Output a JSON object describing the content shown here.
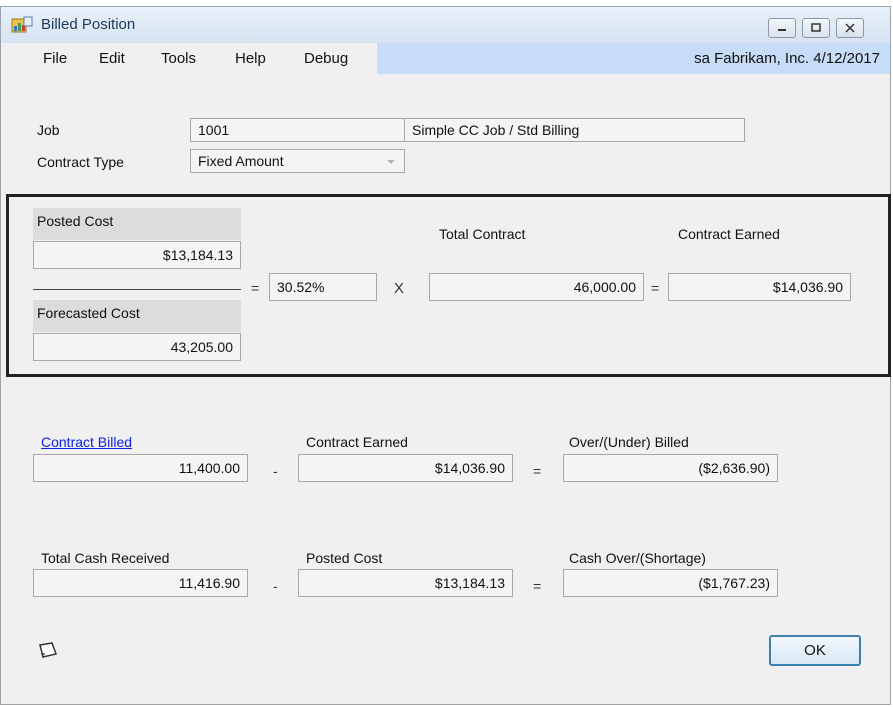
{
  "window": {
    "title": "Billed Position",
    "icon": "billed-position-icon"
  },
  "menu": [
    "File",
    "Edit",
    "Tools",
    "Help",
    "Debug"
  ],
  "session": "sa  Fabrikam, Inc.  4/12/2017",
  "header": {
    "job_label": "Job",
    "job_number": "1001",
    "job_description": "Simple CC Job / Std Billing",
    "contract_type_label": "Contract Type",
    "contract_type_value": "Fixed Amount"
  },
  "calc": {
    "posted_cost_label": "Posted Cost",
    "posted_cost_value": "$13,184.13",
    "forecasted_cost_label": "Forecasted Cost",
    "forecasted_cost_value": "43,205.00",
    "equals": "=",
    "percent": "30.52%",
    "times": "X",
    "total_contract_label": "Total Contract",
    "total_contract_value": "46,000.00",
    "contract_earned_label": "Contract Earned",
    "contract_earned_value": "$14,036.90"
  },
  "billing": {
    "contract_billed_label": "Contract Billed",
    "contract_billed_value": "11,400.00",
    "minus": "-",
    "contract_earned_label": "Contract Earned",
    "contract_earned_value": "$14,036.90",
    "equals": "=",
    "over_under_label": "Over/(Under) Billed",
    "over_under_value": "($2,636.90)"
  },
  "cash": {
    "total_cash_label": "Total Cash Received",
    "total_cash_value": "11,416.90",
    "minus": "-",
    "posted_cost_label": "Posted Cost",
    "posted_cost_value": "$13,184.13",
    "equals": "=",
    "cash_over_label": "Cash Over/(Shortage)",
    "cash_over_value": "($1,767.23)"
  },
  "footer": {
    "ok_label": "OK",
    "note_icon": "note-icon"
  },
  "colors": {
    "link": "#1020e0",
    "menubar_highlight": "#c7dcf6",
    "frame": "#222222"
  }
}
